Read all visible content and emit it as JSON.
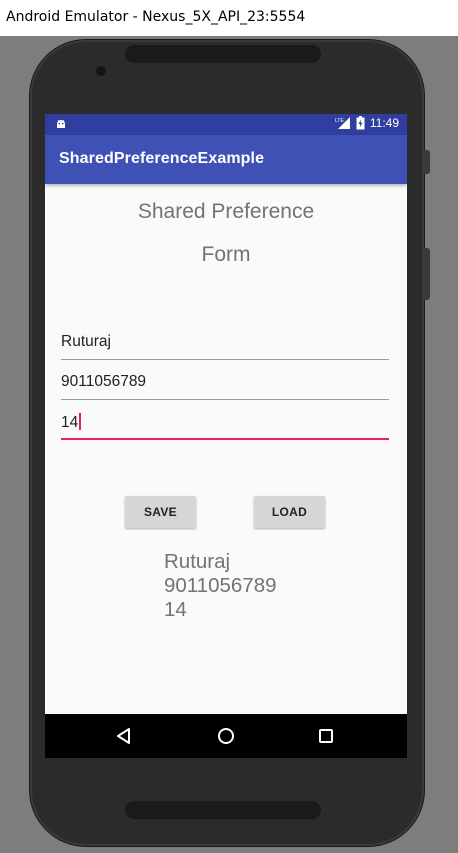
{
  "window": {
    "title": "Android Emulator - Nexus_5X_API_23:5554"
  },
  "status_bar": {
    "network": "LTE",
    "time": "11:49"
  },
  "app_bar": {
    "title": "SharedPreferenceExample"
  },
  "form": {
    "heading_line1": "Shared Preference",
    "heading_line2": "Form",
    "name_value": "Ruturaj",
    "phone_value": "9011056789",
    "age_value": "14"
  },
  "buttons": {
    "save_label": "SAVE",
    "load_label": "LOAD"
  },
  "output": {
    "line1": "Ruturaj",
    "line2": "9011056789",
    "line3": "14"
  },
  "colors": {
    "primary": "#3f51b5",
    "primary_dark": "#303f9f",
    "accent": "#e91e63"
  },
  "icons": [
    "android-icon",
    "lte-signal-icon",
    "battery-charging-icon",
    "back-icon",
    "home-icon",
    "recents-icon"
  ]
}
